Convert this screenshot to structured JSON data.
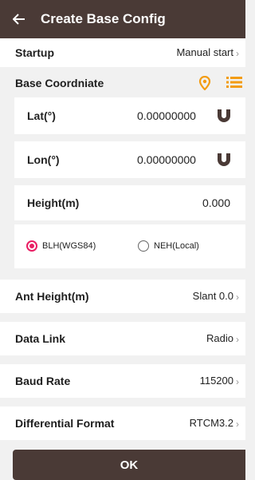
{
  "title": "Create Base Config",
  "startup": {
    "label": "Startup",
    "value": "Manual start"
  },
  "base_coordinate": {
    "label": "Base Coordniate"
  },
  "lat": {
    "label": "Lat(°)",
    "value": "0.00000000"
  },
  "lon": {
    "label": "Lon(°)",
    "value": "0.00000000"
  },
  "height": {
    "label": "Height(m)",
    "value": "0.000"
  },
  "coordinate_type": {
    "options": [
      "BLH(WGS84)",
      "NEH(Local)"
    ],
    "selected": "BLH(WGS84)"
  },
  "ant_height": {
    "label": "Ant Height(m)",
    "value": "Slant 0.0"
  },
  "data_link": {
    "label": "Data Link",
    "value": "Radio"
  },
  "baud_rate": {
    "label": "Baud Rate",
    "value": "115200"
  },
  "differential_format": {
    "label": "Differential Format",
    "value": "RTCM3.2"
  },
  "ok_label": "OK",
  "colors": {
    "header": "#4a3a36",
    "accent": "#f39c12",
    "radio_selected": "#e91e63",
    "magnet": "#4a3a36"
  },
  "icons": [
    "back-arrow-icon",
    "location-pin-icon",
    "list-icon",
    "magnet-icon",
    "chevron-right-icon"
  ]
}
